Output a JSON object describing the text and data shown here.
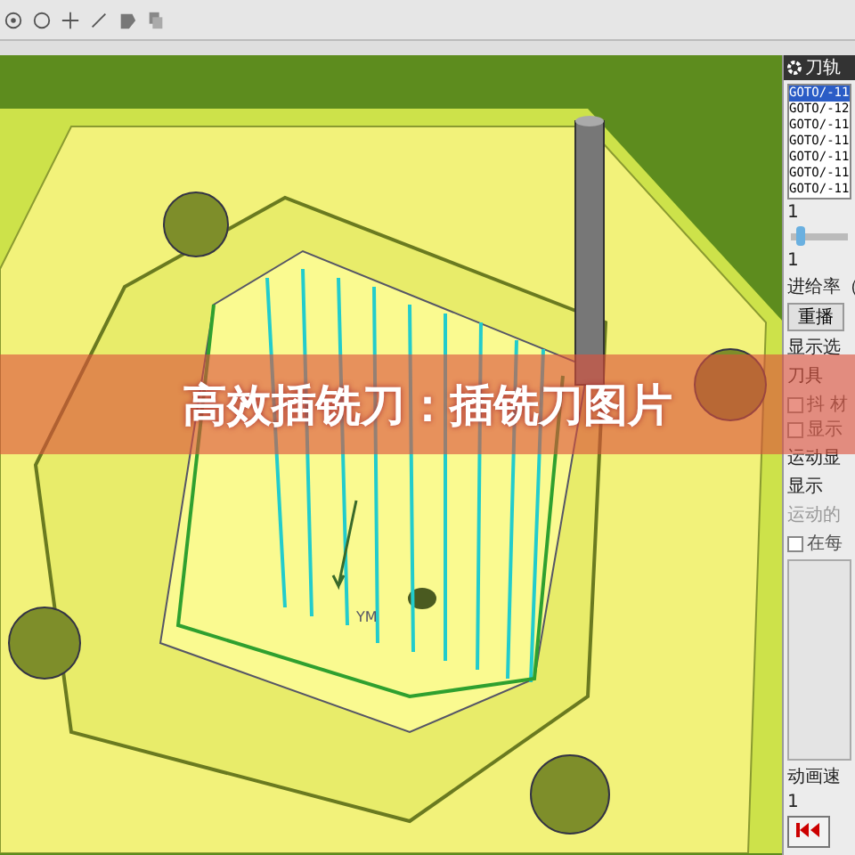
{
  "viewport": {
    "axis_label": "YM"
  },
  "banner": {
    "title": "高效插铣刀：插铣刀图片"
  },
  "panel": {
    "title": "刀轨",
    "toolpath_list": [
      {
        "text": "GOTO/-11",
        "selected": true
      },
      {
        "text": "GOTO/-12",
        "selected": false
      },
      {
        "text": "GOTO/-11",
        "selected": false
      },
      {
        "text": "GOTO/-11",
        "selected": false
      },
      {
        "text": "GOTO/-11",
        "selected": false
      },
      {
        "text": "GOTO/-11",
        "selected": false
      },
      {
        "text": "GOTO/-11",
        "selected": false
      }
    ],
    "slider": {
      "max_label": "1",
      "min_label": "1",
      "level": 0.1
    },
    "feed_label": "进给率（",
    "tab": "重播",
    "display_options": "显示选",
    "tool_label": "刀具",
    "checkboxes_top": [
      {
        "label": "抖 材",
        "checked": false
      },
      {
        "label": "显示",
        "checked": false
      }
    ],
    "motion_display": "运动显",
    "display_label": "显示",
    "motion_label": "运动的",
    "checkboxes_bottom": [
      {
        "label": "在每",
        "checked": false
      }
    ],
    "speed_label": "动画速",
    "speed_value": "1"
  }
}
